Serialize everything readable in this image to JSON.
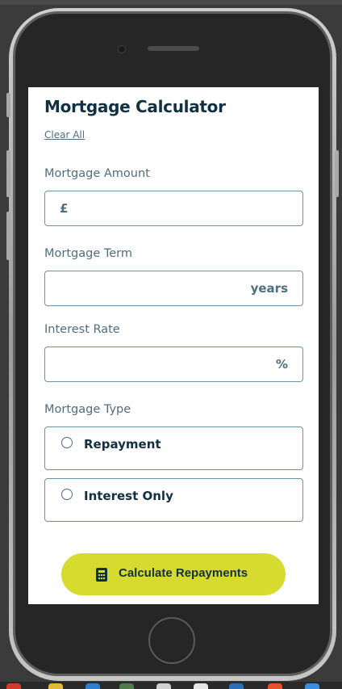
{
  "app": {
    "title": "Mortgage Calculator",
    "clear_all": "Clear All"
  },
  "fields": {
    "amount": {
      "label": "Mortgage Amount",
      "prefix": "£",
      "value": ""
    },
    "term": {
      "label": "Mortgage Term",
      "suffix": "years",
      "value": ""
    },
    "rate": {
      "label": "Interest Rate",
      "suffix": "%",
      "value": ""
    }
  },
  "mortgage_type": {
    "label": "Mortgage Type",
    "options": [
      {
        "label": "Repayment",
        "selected": false
      },
      {
        "label": "Interest Only",
        "selected": false
      }
    ]
  },
  "submit": {
    "label": "Calculate Repayments",
    "icon": "calculator-icon"
  },
  "colors": {
    "accent": "#d7da2f",
    "heading": "#133041",
    "muted": "#4e6e7e",
    "border": "#6b94a8"
  }
}
